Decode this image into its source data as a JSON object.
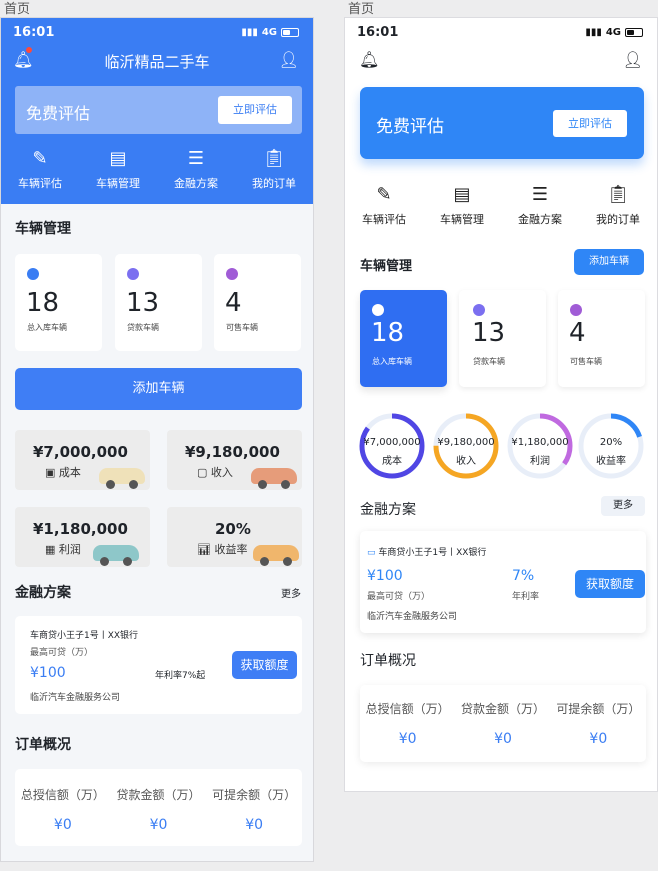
{
  "captions": {
    "left": "首页",
    "right": "首页"
  },
  "status": {
    "time": "16:01",
    "network": "4G"
  },
  "header": {
    "title": "临沂精品二手车"
  },
  "evaluate": {
    "title": "免费评估",
    "button": "立即评估"
  },
  "quick_nav": [
    {
      "label": "车辆评估",
      "icon": "edit-doc-icon"
    },
    {
      "label": "车辆管理",
      "icon": "car-doc-icon"
    },
    {
      "label": "金融方案",
      "icon": "list-doc-icon"
    },
    {
      "label": "我的订单",
      "icon": "clipboard-icon"
    }
  ],
  "vehicle": {
    "title": "车辆管理",
    "add_button": "添加车辆",
    "stats": [
      {
        "value": "18",
        "label": "总入库车辆",
        "color": "#3a7df3"
      },
      {
        "value": "13",
        "label": "贷款车辆",
        "color": "#7b6ff0"
      },
      {
        "value": "4",
        "label": "可售车辆",
        "color": "#a05cd6"
      }
    ]
  },
  "finance_stats": [
    {
      "value": "¥7,000,000",
      "label": "成本",
      "color": "#5046e4",
      "ring": 0.85
    },
    {
      "value": "¥9,180,000",
      "label": "收入",
      "color": "#f5a623",
      "ring": 0.75
    },
    {
      "value": "¥1,180,000",
      "label": "利润",
      "color": "#c06ae0",
      "ring": 0.35
    },
    {
      "value": "20%",
      "label": "收益率",
      "color": "#2f86f6",
      "ring": 0.2
    }
  ],
  "finance": {
    "title": "金融方案",
    "more": "更多",
    "product": "车商贷小王子1号丨XX银行",
    "max_label": "最高可贷（万）",
    "amount": "¥100",
    "rate_label": "年利率7%起",
    "rate_value": "7%",
    "rate_text": "年利率",
    "company": "临沂汽车金融服务公司",
    "button": "获取额度"
  },
  "orders": {
    "title": "订单概况",
    "columns": [
      {
        "label": "总授信额（万）",
        "value": "¥0"
      },
      {
        "label": "贷款金额（万）",
        "value": "¥0"
      },
      {
        "label": "可提余额（万）",
        "value": "¥0"
      }
    ]
  }
}
